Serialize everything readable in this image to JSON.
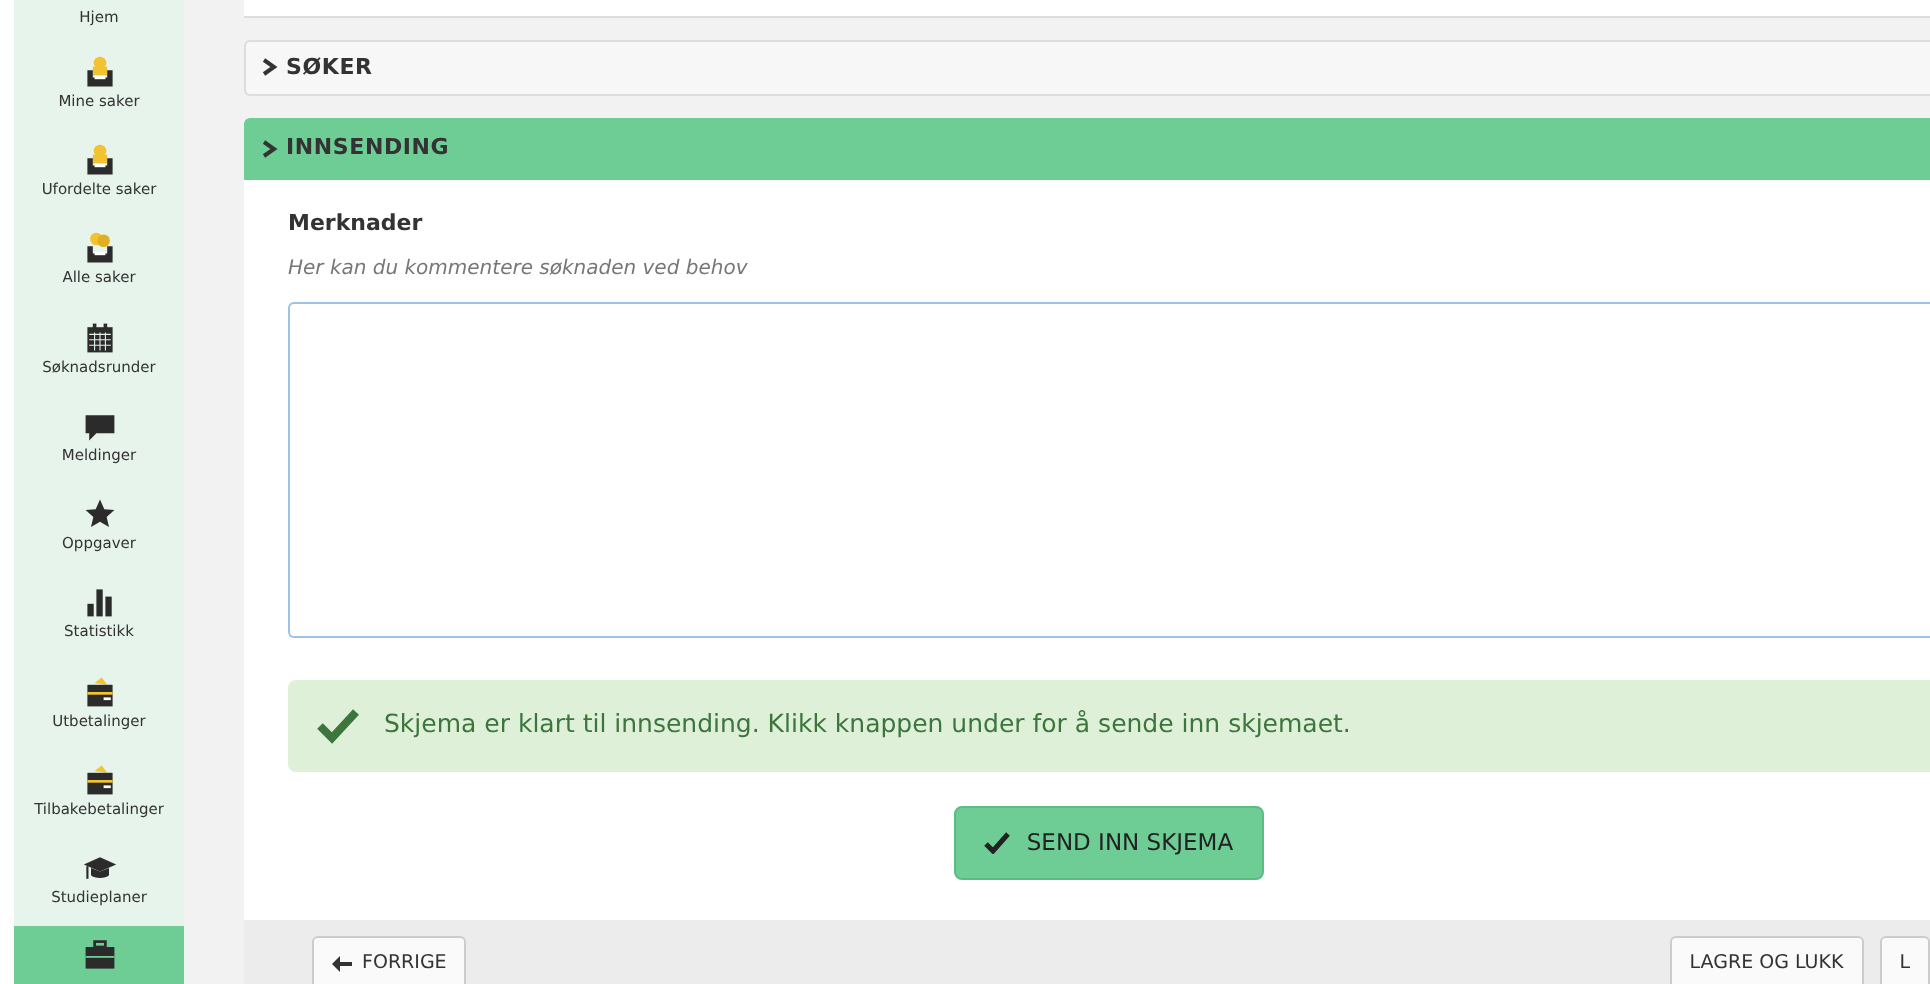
{
  "sidebar": {
    "items": [
      {
        "label": "Hjem",
        "kind": "text",
        "selected": false
      },
      {
        "label": "Mine saker",
        "kind": "mine",
        "selected": false
      },
      {
        "label": "Ufordelte saker",
        "kind": "mine",
        "selected": false
      },
      {
        "label": "Alle saker",
        "kind": "all",
        "selected": false
      },
      {
        "label": "Søknadsrunder",
        "kind": "calendar",
        "selected": false
      },
      {
        "label": "Meldinger",
        "kind": "messages",
        "selected": false
      },
      {
        "label": "Oppgaver",
        "kind": "tasks",
        "selected": false
      },
      {
        "label": "Statistikk",
        "kind": "statistics",
        "selected": false
      },
      {
        "label": "Utbetalinger",
        "kind": "payments",
        "selected": false
      },
      {
        "label": "Tilbakebetalinger",
        "kind": "payments",
        "selected": false
      },
      {
        "label": "Studieplaner",
        "kind": "plans",
        "selected": false
      },
      {
        "kind": "cases",
        "selected": true
      }
    ]
  },
  "sections": [
    {
      "title": "SØKER",
      "expanded": false
    },
    {
      "title": "INNSENDING",
      "expanded": true
    }
  ],
  "form": {
    "label": "Merknader",
    "hint": "Her kan du kommentere søknaden ved behov"
  },
  "alert": "Skjema er klart til innsending. Klikk knappen under for å sende inn skjemaet.",
  "submit_button": "SEND INN SKJEMA",
  "footer": {
    "back_button": "FORRIGE",
    "buttons": [
      "LAGRE OG LUKK",
      "L"
    ]
  }
}
